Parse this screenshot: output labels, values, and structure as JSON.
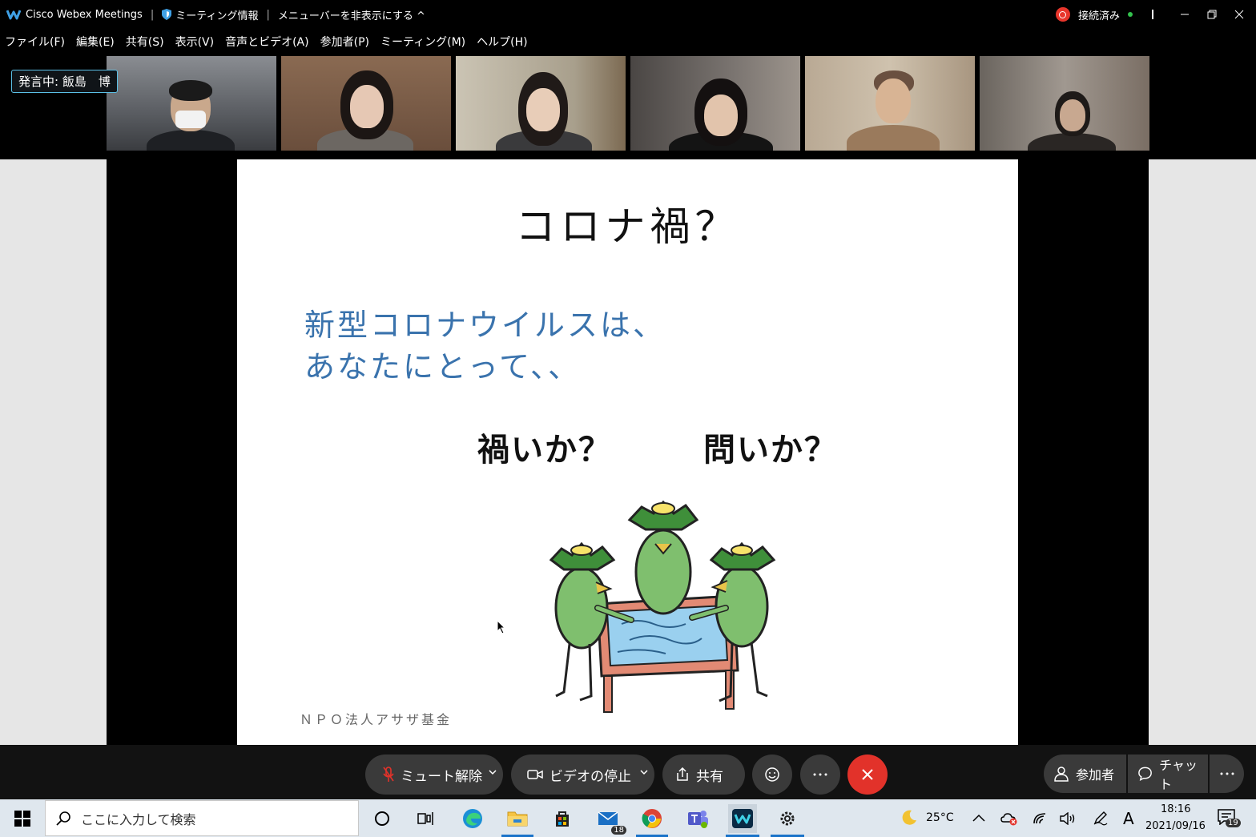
{
  "titlebar": {
    "app_title": "Cisco Webex Meetings",
    "separator": "|",
    "meeting_info": "ミーティング情報",
    "hide_menubar": "メニューバーを非表示にする ^",
    "status": "接続済み"
  },
  "menubar": {
    "items": [
      "ファイル(F)",
      "編集(E)",
      "共有(S)",
      "表示(V)",
      "音声とビデオ(A)",
      "参加者(P)",
      "ミーティング(M)",
      "ヘルプ(H)"
    ]
  },
  "video_strip": {
    "speaker_badge": "発言中: 飯島　博"
  },
  "slide": {
    "title": "コロナ禍？",
    "subtitle_line1": "新型コロナウイルスは、",
    "subtitle_line2": "あなたにとって、、",
    "question1": "禍いか？",
    "question2": "問いか？",
    "footer": "ＮＰＯ法人アサザ基金"
  },
  "controls": {
    "mute": "ミュート解除",
    "video": "ビデオの停止",
    "share": "共有",
    "participants": "参加者",
    "chat": "チャット"
  },
  "taskbar": {
    "search_placeholder": "ここに入力して検索",
    "mail_badge": "18",
    "weather": "25°C",
    "ime": "A",
    "time": "18:16",
    "date": "2021/09/16",
    "notif_count": "19"
  },
  "colors": {
    "accent_blue": "#3a73ad",
    "leave_red": "#e2322a",
    "speaker_border": "#5bc0e6"
  }
}
